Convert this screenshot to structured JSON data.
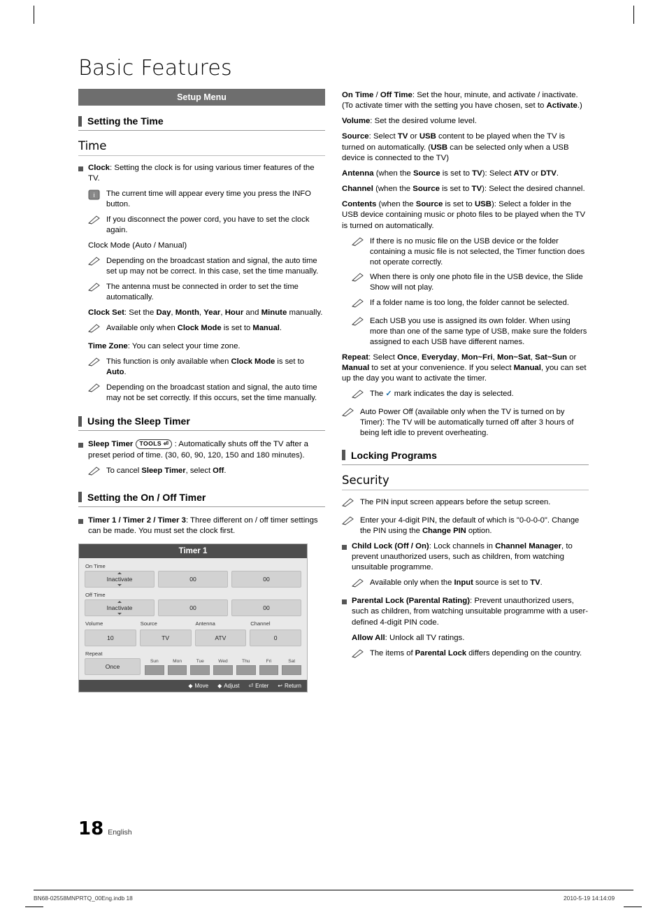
{
  "page": {
    "title": "Basic Features",
    "setup_menu_bar": "Setup Menu",
    "page_number": "18",
    "language": "English",
    "footer_left": "BN68-02558MNPRTQ_00Eng.indb   18",
    "footer_right": "2010-5-19   14:14:09"
  },
  "left": {
    "section1": "Setting the Time",
    "sub1": "Time",
    "clock_item": "Clock: Setting the clock is for using various timer features of the TV.",
    "note_info": "The current time will appear every time you press the INFO button.",
    "note_power": "If you disconnect the power cord, you have to set the clock again.",
    "clock_mode_head": "Clock Mode (Auto / Manual)",
    "note_auto1": "Depending on the broadcast station and signal, the auto time set up may not be correct. In this case, set the time manually.",
    "note_auto2": "The antenna must be connected in order to set the time automatically.",
    "clock_set": "Clock Set: Set the Day, Month, Year, Hour and Minute manually.",
    "note_clockset": "Available only when Clock Mode is set to Manual.",
    "time_zone": "Time Zone: You can select your time zone.",
    "note_tz1": "This function is only available when Clock Mode is set to Auto.",
    "note_tz2": "Depending on the broadcast station and signal, the auto time may not be set correctly. If this occurs, set the time manually.",
    "section2": "Using the Sleep Timer",
    "sleep_timer_label": "Sleep Timer",
    "tools_badge": "TOOLS",
    "sleep_timer_text": ": Automatically shuts off the TV after a preset period of time. (30, 60, 90, 120, 150 and 180 minutes).",
    "note_sleep": "To cancel Sleep Timer, select Off.",
    "section3": "Setting the On / Off Timer",
    "timer_item": "Timer 1 / Timer 2 / Timer 3: Three different on / off timer settings can be made. You must set the clock first."
  },
  "osd": {
    "title": "Timer 1",
    "on_time_label": "On Time",
    "off_time_label": "Off Time",
    "on_time_state": "Inactivate",
    "off_time_state": "Inactivate",
    "on_hour": "00",
    "on_min": "00",
    "off_hour": "00",
    "off_min": "00",
    "volume_label": "Volume",
    "volume_value": "10",
    "source_label": "Source",
    "source_value": "TV",
    "antenna_label": "Antenna",
    "antenna_value": "ATV",
    "channel_label": "Channel",
    "channel_value": "0",
    "repeat_label": "Repeat",
    "repeat_value": "Once",
    "days": [
      "Sun",
      "Mon",
      "Tue",
      "Wed",
      "Thu",
      "Fri",
      "Sat"
    ],
    "footer": [
      "Move",
      "Adjust",
      "Enter",
      "Return"
    ]
  },
  "right": {
    "on_off_time": "On Time / Off Time: Set the hour, minute, and activate / inactivate. (To activate timer with the setting you have chosen, set to Activate.)",
    "volume": "Volume: Set the desired volume level.",
    "source": "Source: Select TV or USB content to be played when the TV is turned on automatically. (USB can be selected only when a USB device is connected to the TV)",
    "antenna": "Antenna (when the Source is set to TV): Select ATV or DTV.",
    "channel": "Channel (when the Source is set to TV): Select the desired channel.",
    "contents": "Contents (when the Source is set to USB): Select a folder in the USB device containing music or photo files to be played when the TV is turned on automatically.",
    "note_c1": "If there is no music file on the USB device or the folder containing a music file is not selected, the Timer function does not operate correctly.",
    "note_c2": "When there is only one photo file in the USB device, the Slide Show will not play.",
    "note_c3": "If a folder name is too long, the folder cannot be selected.",
    "note_c4": "Each USB you use is assigned its own folder. When using more than one of the same type of USB, make sure the folders assigned to each USB have different names.",
    "repeat": "Repeat: Select Once, Everyday, Mon~Fri, Mon~Sat, Sat~Sun or Manual to set at your convenience. If you select Manual, you can set up the day you want to activate the timer.",
    "note_mark_pre": "The",
    "note_mark_post": "mark indicates the day is selected.",
    "note_auto_power": "Auto Power Off (available only when the TV is turned on by Timer): The TV will be automatically turned off after 3 hours of being left idle to prevent overheating.",
    "section_locking": "Locking Programs",
    "sub_security": "Security",
    "note_pin1": "The PIN input screen appears before the setup screen.",
    "note_pin2": "Enter your 4-digit PIN, the default of which is \"0-0-0-0\". Change the PIN using the Change PIN option.",
    "child_lock": "Child Lock (Off / On): Lock channels in Channel Manager, to prevent unauthorized users, such as children, from watching unsuitable programme.",
    "note_child": "Available only when the Input source is set to TV.",
    "parental_lock": "Parental Lock (Parental Rating): Prevent unauthorized users, such as children, from watching unsuitable programme with a user-defined 4-digit PIN code.",
    "allow_all": "Allow All: Unlock all TV ratings.",
    "note_parental": "The items of Parental Lock differs depending on the country."
  }
}
